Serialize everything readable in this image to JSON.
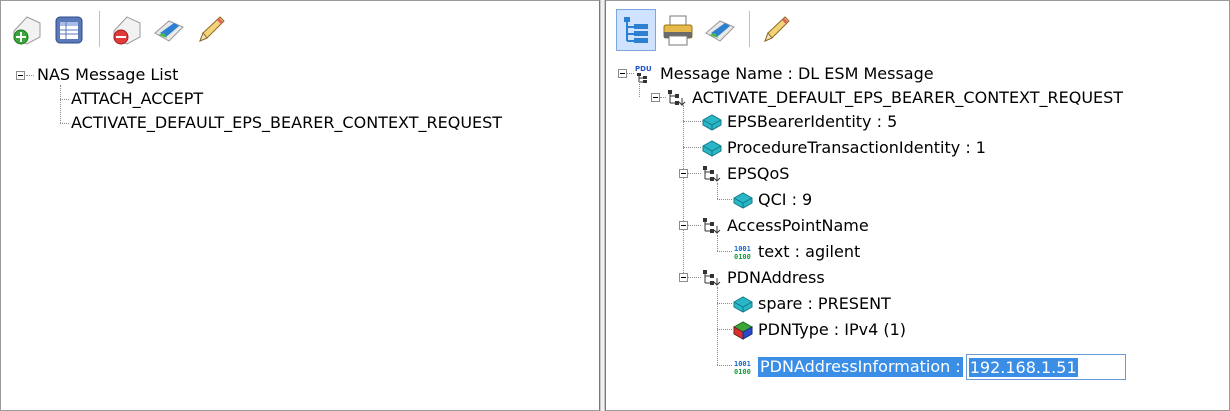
{
  "left_tree": {
    "root": "NAS Message List",
    "children": [
      "ATTACH_ACCEPT",
      "ACTIVATE_DEFAULT_EPS_BEARER_CONTEXT_REQUEST"
    ]
  },
  "right_tree": {
    "root": "Message Name : DL ESM Message",
    "message": "ACTIVATE_DEFAULT_EPS_BEARER_CONTEXT_REQUEST",
    "eps_bearer_identity": "EPSBearerIdentity : 5",
    "procedure_transaction_identity": "ProcedureTransactionIdentity : 1",
    "eps_qos": "EPSQoS",
    "qci": "QCI : 9",
    "access_point_name": "AccessPointName",
    "apn_text": "text : agilent",
    "pdn_address": "PDNAddress",
    "spare": "spare : PRESENT",
    "pdn_type": "PDNType : IPv4 (1)",
    "pdn_address_information_label": "PDNAddressInformation :",
    "pdn_address_information_value": "192.168.1.51"
  },
  "colors": {
    "selection": "#3a8ee6",
    "toolbar_active": "#cfe3ff",
    "accent": "#6a9bd6"
  },
  "icons": {
    "left_toolbar": [
      "add-message-icon",
      "table-icon",
      "remove-message-icon",
      "send-icon",
      "edit-icon"
    ],
    "right_toolbar": [
      "tree-view-icon",
      "print-icon",
      "send-icon",
      "edit-icon"
    ],
    "tree_nodes": [
      "pdu-icon",
      "structure-icon",
      "field-icon",
      "enum-field-icon",
      "binary-icon"
    ]
  }
}
